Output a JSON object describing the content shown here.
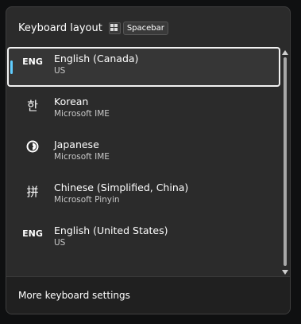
{
  "flyout": {
    "title": "Keyboard layout",
    "shortcut_win_key_icon": "windows-logo-icon",
    "shortcut_key": "Spacebar"
  },
  "layouts": [
    {
      "icon_text": "ENG",
      "icon_name": "eng-text-icon",
      "name": "English (Canada)",
      "sub": "US",
      "selected": true
    },
    {
      "icon_text": "한",
      "icon_name": "hangul-ime-icon",
      "name": "Korean",
      "sub": "Microsoft IME",
      "selected": false
    },
    {
      "icon_text": "",
      "icon_name": "japanese-ime-icon",
      "name": "Japanese",
      "sub": "Microsoft IME",
      "selected": false
    },
    {
      "icon_text": "拼",
      "icon_name": "pinyin-ime-icon",
      "name": "Chinese (Simplified, China)",
      "sub": "Microsoft Pinyin",
      "selected": false
    },
    {
      "icon_text": "ENG",
      "icon_name": "eng-text-icon",
      "name": "English (United States)",
      "sub": "US",
      "selected": false
    }
  ],
  "footer": {
    "link_label": "More keyboard settings"
  },
  "colors": {
    "accent": "#60cdff",
    "background": "#2b2b2b",
    "footer_background": "#202020"
  }
}
